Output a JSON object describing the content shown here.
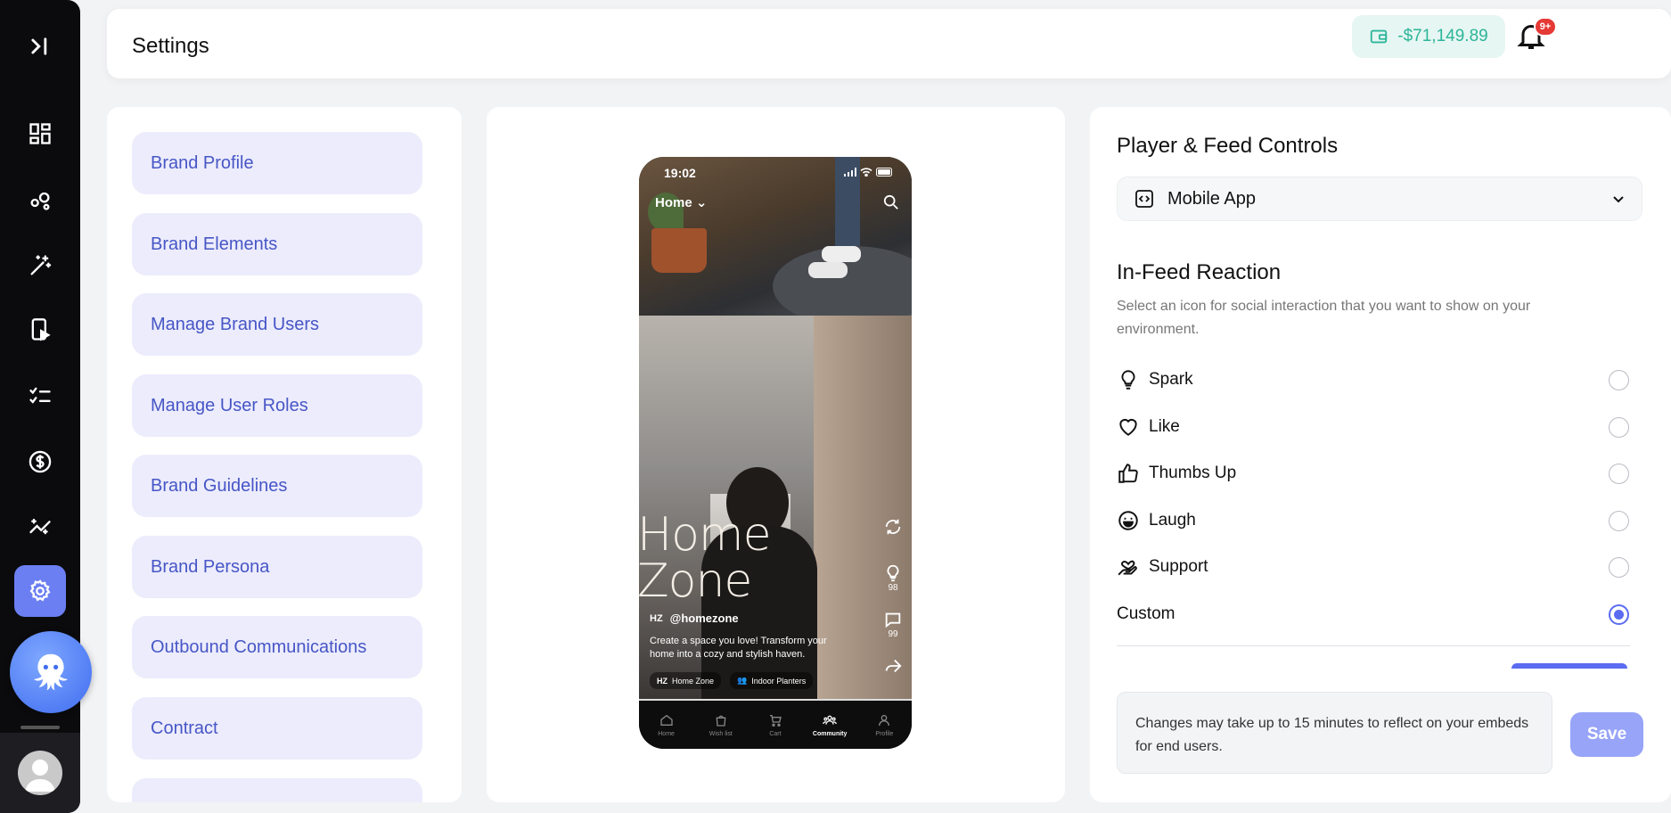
{
  "header": {
    "title": "Settings",
    "balance": "-$71,149.89",
    "notification_badge": "9+"
  },
  "rail": {
    "icons": [
      "expand-sidebar-icon",
      "dashboard-icon",
      "analytics-icon",
      "magic-wand-icon",
      "video-icon",
      "tasks-icon",
      "billing-icon",
      "insights-icon",
      "settings-icon"
    ],
    "active": "settings-icon"
  },
  "menu": {
    "items": [
      {
        "label": "Brand Profile"
      },
      {
        "label": "Brand Elements"
      },
      {
        "label": "Manage Brand Users"
      },
      {
        "label": "Manage User Roles"
      },
      {
        "label": "Brand Guidelines"
      },
      {
        "label": "Brand Persona"
      },
      {
        "label": "Outbound Communications"
      },
      {
        "label": "Contract"
      }
    ]
  },
  "phone": {
    "time": "19:02",
    "feed_selector": "Home",
    "video_overlay_text_line1": "Home",
    "video_overlay_text_line2": "Zone",
    "author_badge": "HZ",
    "author_handle": "@homezone",
    "caption": "Create a space you love! Transform your home into a cozy and stylish haven.",
    "chip1_badge": "HZ",
    "chip1": "Home Zone",
    "chip2": "Indoor Planters",
    "spark_count": "98",
    "comment_count": "99",
    "tabs": [
      {
        "label": "Home"
      },
      {
        "label": "Wish list"
      },
      {
        "label": "Cart"
      },
      {
        "label": "Community"
      },
      {
        "label": "Profile"
      }
    ],
    "active_tab": "Community"
  },
  "controls": {
    "title": "Player & Feed Controls",
    "platform_select": "Mobile App",
    "reaction_section": {
      "title": "In-Feed Reaction",
      "description": "Select an icon for social interaction that you want to show on your environment.",
      "options": [
        {
          "label": "Spark",
          "icon": "lightbulb-icon",
          "selected": false
        },
        {
          "label": "Like",
          "icon": "heart-icon",
          "selected": false
        },
        {
          "label": "Thumbs Up",
          "icon": "thumbs-up-icon",
          "selected": false
        },
        {
          "label": "Laugh",
          "icon": "laugh-icon",
          "selected": false
        },
        {
          "label": "Support",
          "icon": "support-hand-icon",
          "selected": false
        },
        {
          "label": "Custom",
          "icon": "",
          "selected": true
        }
      ]
    },
    "note": "Changes may take up to 15 minutes to reflect on your embeds for end users.",
    "save_label": "Save"
  },
  "colors": {
    "accent": "#5b6cf0",
    "menu_item_bg": "#ececfc",
    "menu_item_text": "#4756c6",
    "balance_text": "#2cb59a"
  }
}
